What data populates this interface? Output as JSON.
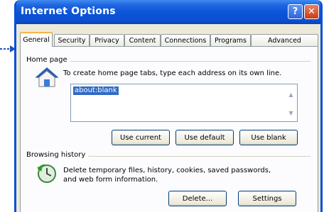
{
  "window": {
    "title": "Internet Options",
    "help_glyph": "?",
    "close_glyph": "✕"
  },
  "tabs": [
    {
      "label": "General",
      "active": true
    },
    {
      "label": "Security",
      "active": false
    },
    {
      "label": "Privacy",
      "active": false
    },
    {
      "label": "Content",
      "active": false
    },
    {
      "label": "Connections",
      "active": false
    },
    {
      "label": "Programs",
      "active": false
    },
    {
      "label": "Advanced",
      "active": false
    }
  ],
  "home_page": {
    "group_title": "Home page",
    "icon": "house-icon",
    "instruction": "To create home page tabs, type each address on its own line.",
    "url_value": "about:blank",
    "buttons": {
      "use_current": "Use current",
      "use_default": "Use default",
      "use_blank": "Use blank"
    }
  },
  "browsing_history": {
    "group_title": "Browsing history",
    "icon": "history-clock-icon",
    "description_line1": "Delete temporary files, history, cookies, saved passwords,",
    "description_line2": "and web form information.",
    "buttons": {
      "delete": "Delete...",
      "settings": "Settings"
    }
  },
  "colors": {
    "titlebar": "#0a54d8",
    "selection": "#316ac5",
    "active_tab_accent": "#f7b54a",
    "arrow": "#1f4fc4"
  }
}
